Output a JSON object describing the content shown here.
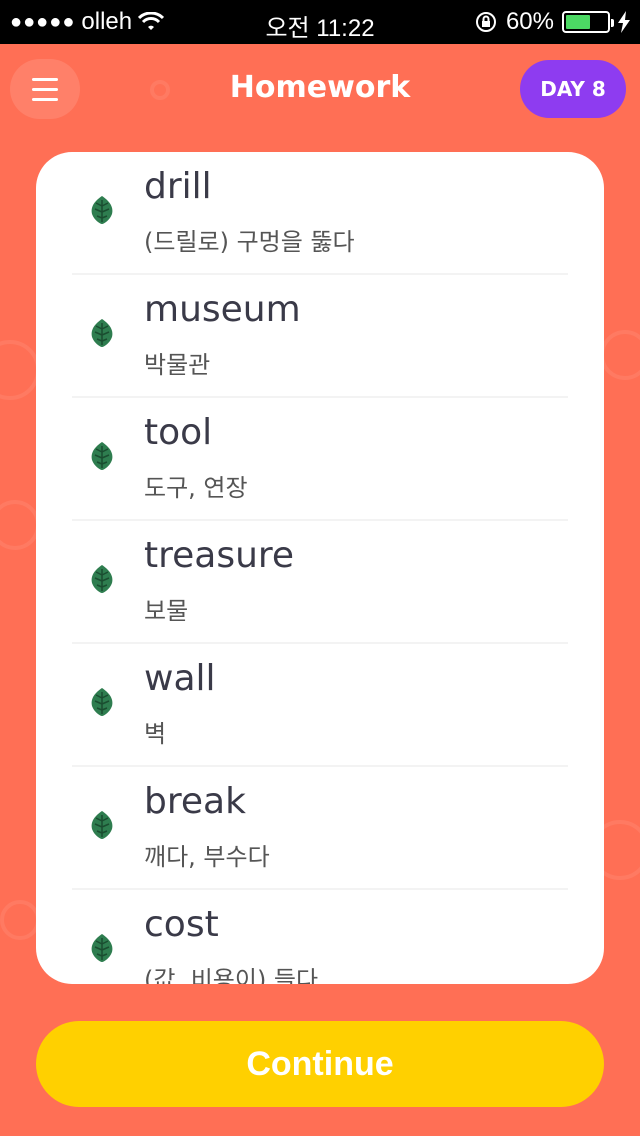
{
  "status_bar": {
    "carrier": "olleh",
    "time": "오전 11:22",
    "battery_percent": "60%",
    "battery_level": 0.6
  },
  "header": {
    "title": "Homework",
    "day_badge": "DAY 8"
  },
  "words": [
    {
      "word": "drill",
      "meaning": "(드릴로) 구멍을 뚫다"
    },
    {
      "word": "museum",
      "meaning": "박물관"
    },
    {
      "word": "tool",
      "meaning": "도구, 연장"
    },
    {
      "word": "treasure",
      "meaning": "보물"
    },
    {
      "word": "wall",
      "meaning": "벽"
    },
    {
      "word": "break",
      "meaning": "깨다, 부수다"
    },
    {
      "word": "cost",
      "meaning": "(값, 비용이) 들다"
    }
  ],
  "continue_label": "Continue",
  "colors": {
    "background": "#ff6f55",
    "badge": "#8e3cf0",
    "button": "#ffd000",
    "leaf": "#2e7d4f"
  }
}
